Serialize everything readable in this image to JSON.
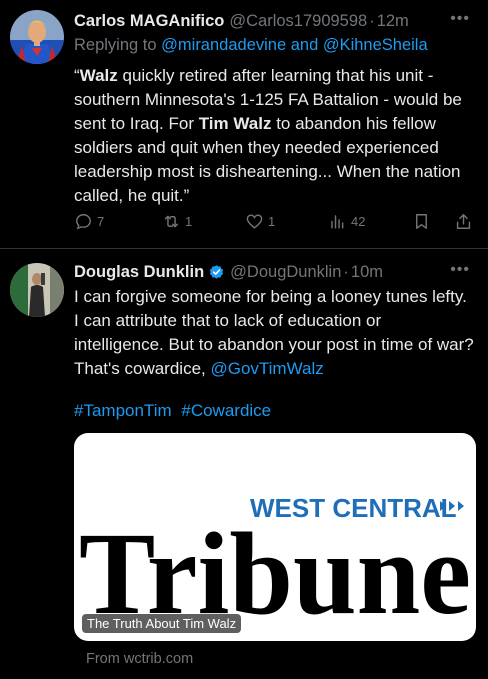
{
  "tweets": [
    {
      "display_name": "Carlos MAGAnifico",
      "handle": "@Carlos17909598",
      "time": "12m",
      "replying_to_prefix": "Replying to",
      "reply_mentions": "@mirandadevine and @KihneSheila",
      "text_segments": [
        "“",
        "Walz",
        " quickly retired after learning that his unit -southern Minnesota's 1-125 FA Battalion - would be sent to Iraq. For ",
        "Tim Walz",
        " to abandon his fellow soldiers and quit when they needed experienced leadership most is disheartening... When the nation called, he quit.”"
      ],
      "stats": {
        "replies": "7",
        "reposts": "1",
        "likes": "1",
        "views": "42"
      },
      "avatar_icon": "superhero-avatar"
    },
    {
      "display_name": "Douglas Dunklin",
      "handle": "@DougDunklin",
      "time": "10m",
      "verified": true,
      "text": "I can forgive someone for being a looney tunes lefty.  I can attribute that to lack of education or intelligence.  But to abandon your post in time of war?  That's cowardice, ",
      "text_mention": "@GovTimWalz",
      "hashtags": [
        "#TamponTim",
        "#Cowardice"
      ],
      "card": {
        "brand_top": "WEST CENTRAL",
        "brand_main": "Tribune",
        "label": "The Truth About Tim Walz",
        "source": "From wctrib.com",
        "brand_color": "#1e6fb8"
      },
      "avatar_icon": "person-photo-avatar"
    }
  ],
  "colors": {
    "background": "#000000",
    "text": "#e7e9ea",
    "muted": "#71767b",
    "accent": "#1d9bf0",
    "divider": "#2f3336"
  }
}
